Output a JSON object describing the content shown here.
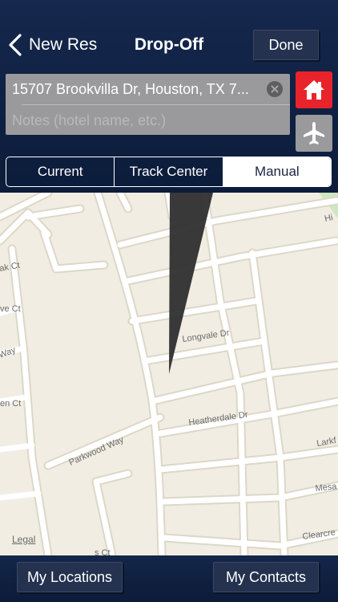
{
  "navbar": {
    "back_label": "New Res",
    "title": "Drop-Off",
    "done_label": "Done"
  },
  "fields": {
    "address_value": "15707 Brookvilla Dr, Houston, TX 7...",
    "notes_placeholder": "Notes (hotel name, etc.)"
  },
  "quick_buttons": {
    "home_icon": "home-icon",
    "airport_icon": "airplane-icon"
  },
  "segmented": {
    "items": [
      "Current",
      "Track Center",
      "Manual"
    ],
    "selected": "Manual"
  },
  "map": {
    "street_labels": {
      "longvale": "Longvale Dr",
      "heatherdale": "Heatherdale Dr",
      "parkwood": "Parkwood Way",
      "larkf": "Larkf",
      "mesa": "Mesa",
      "clearcre": "Clearcre",
      "hi": "Hi",
      "ak_ct": "ak Ct",
      "ve_ct": "ve Ct",
      "way": "Way",
      "en_ct": "en Ct",
      "s_ct": "s Ct"
    },
    "legal_label": "Legal"
  },
  "bottom": {
    "locations_label": "My Locations",
    "contacts_label": "My Contacts"
  },
  "colors": {
    "header_bg": "#0f2143",
    "home_button": "#e8232b",
    "map_land": "#f1ede2",
    "road": "#ffffff",
    "road_edge": "#d9d3c4"
  }
}
